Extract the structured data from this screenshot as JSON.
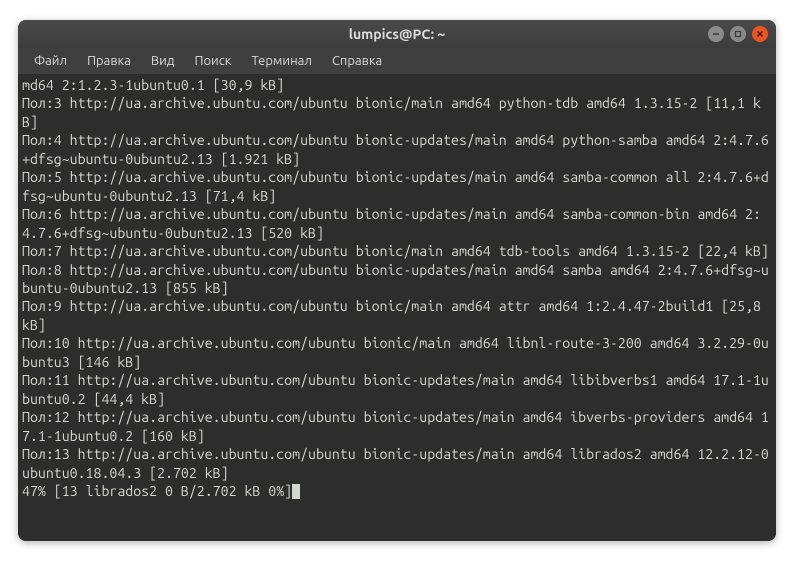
{
  "titlebar": {
    "title": "lumpics@PC: ~"
  },
  "window_controls": {
    "minimize": "minimize",
    "maximize": "maximize",
    "close": "close"
  },
  "menubar": {
    "items": [
      "Файл",
      "Правка",
      "Вид",
      "Поиск",
      "Терминал",
      "Справка"
    ]
  },
  "terminal_lines": [
    "md64 2:1.2.3-1ubuntu0.1 [30,9 kB]",
    "Пол:3 http://ua.archive.ubuntu.com/ubuntu bionic/main amd64 python-tdb amd64 1.3.15-2 [11,1 kB]",
    "Пол:4 http://ua.archive.ubuntu.com/ubuntu bionic-updates/main amd64 python-samba amd64 2:4.7.6+dfsg~ubuntu-0ubuntu2.13 [1.921 kB]",
    "Пол:5 http://ua.archive.ubuntu.com/ubuntu bionic-updates/main amd64 samba-common all 2:4.7.6+dfsg~ubuntu-0ubuntu2.13 [71,4 kB]",
    "Пол:6 http://ua.archive.ubuntu.com/ubuntu bionic-updates/main amd64 samba-common-bin amd64 2:4.7.6+dfsg~ubuntu-0ubuntu2.13 [520 kB]",
    "Пол:7 http://ua.archive.ubuntu.com/ubuntu bionic/main amd64 tdb-tools amd64 1.3.15-2 [22,4 kB]",
    "Пол:8 http://ua.archive.ubuntu.com/ubuntu bionic-updates/main amd64 samba amd64 2:4.7.6+dfsg~ubuntu-0ubuntu2.13 [855 kB]",
    "Пол:9 http://ua.archive.ubuntu.com/ubuntu bionic/main amd64 attr amd64 1:2.4.47-2build1 [25,8 kB]",
    "Пол:10 http://ua.archive.ubuntu.com/ubuntu bionic/main amd64 libnl-route-3-200 amd64 3.2.29-0ubuntu3 [146 kB]",
    "Пол:11 http://ua.archive.ubuntu.com/ubuntu bionic-updates/main amd64 libibverbs1 amd64 17.1-1ubuntu0.2 [44,4 kB]",
    "Пол:12 http://ua.archive.ubuntu.com/ubuntu bionic-updates/main amd64 ibverbs-providers amd64 17.1-1ubuntu0.2 [160 kB]",
    "Пол:13 http://ua.archive.ubuntu.com/ubuntu bionic-updates/main amd64 librados2 amd64 12.2.12-0ubuntu0.18.04.3 [2.702 kB]",
    "47% [13 librados2 0 B/2.702 kB 0%]"
  ]
}
